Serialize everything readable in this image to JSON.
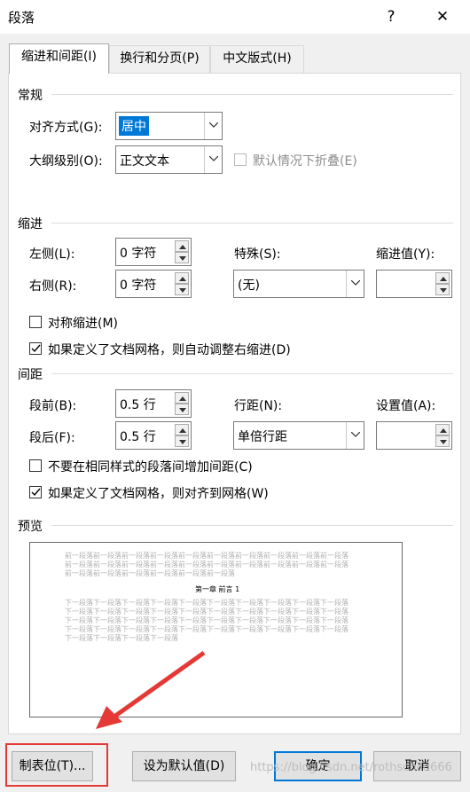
{
  "window": {
    "title": "段落",
    "help_glyph": "?",
    "close_glyph": "✕"
  },
  "tabs": [
    {
      "label": "缩进和间距(I)"
    },
    {
      "label": "换行和分页(P)"
    },
    {
      "label": "中文版式(H)"
    }
  ],
  "general": {
    "title": "常规",
    "alignment_label": "对齐方式(G):",
    "alignment_value": "居中",
    "outline_label": "大纲级别(O):",
    "outline_value": "正文文本",
    "collapse_label": "默认情况下折叠(E)"
  },
  "indent": {
    "title": "缩进",
    "left_label": "左侧(L):",
    "left_value": "0 字符",
    "right_label": "右侧(R):",
    "right_value": "0 字符",
    "special_label": "特殊(S):",
    "special_value": "(无)",
    "by_label": "缩进值(Y):",
    "by_value": "",
    "mirror_label": "对称缩进(M)",
    "mirror_checked": false,
    "auto_adjust_label": "如果定义了文档网格，则自动调整右缩进(D)",
    "auto_adjust_checked": true
  },
  "spacing": {
    "title": "间距",
    "before_label": "段前(B):",
    "before_value": "0.5 行",
    "after_label": "段后(F):",
    "after_value": "0.5 行",
    "line_label": "行距(N):",
    "line_value": "单倍行距",
    "at_label": "设置值(A):",
    "at_value": "",
    "no_space_label": "不要在相同样式的段落间增加间距(C)",
    "no_space_checked": false,
    "snap_grid_label": "如果定义了文档网格，则对齐到网格(W)",
    "snap_grid_checked": true
  },
  "preview": {
    "title": "预览",
    "prev_lines": [
      "前一段落前一段落前一段落前一段落前一段落前一段落前一段落前一段落前一段落前一段落",
      "前一段落前一段落前一段落前一段落前一段落前一段落前一段落前一段落前一段落前一段落",
      "前一段落前一段落前一段落前一段落前一段落前一段落"
    ],
    "main_text": "第一章  前言    1",
    "next_lines": [
      "下一段落下一段落下一段落下一段落下一段落下一段落下一段落下一段落下一段落下一段落",
      "下一段落下一段落下一段落下一段落下一段落下一段落下一段落下一段落下一段落下一段落",
      "下一段落下一段落下一段落下一段落下一段落下一段落下一段落下一段落下一段落下一段落",
      "下一段落下一段落下一段落下一段落下一段落下一段落下一段落下一段落下一段落下一段落",
      "下一段落下一段落下一段落下一段落"
    ]
  },
  "buttons": {
    "tabs": "制表位(T)...",
    "set_default": "设为默认值(D)",
    "ok": "确定",
    "cancel": "取消"
  },
  "watermark": "https://blog.csdn.net/rothschild666",
  "colors": {
    "selection": "#0078d7",
    "annotation": "#e53935"
  }
}
